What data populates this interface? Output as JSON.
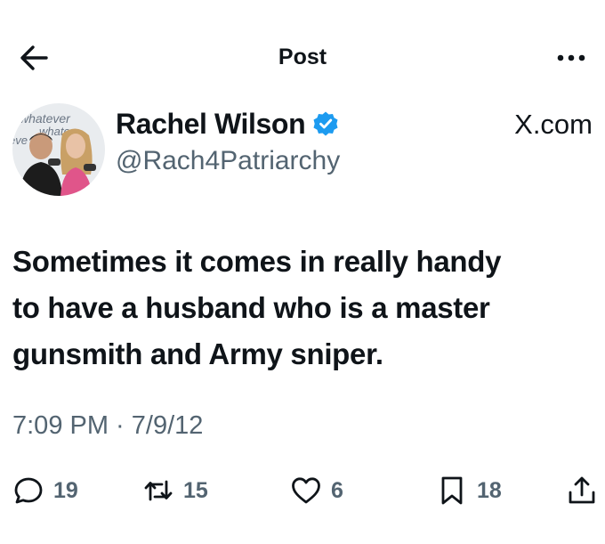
{
  "header": {
    "title": "Post",
    "back_icon": "arrow-left-icon",
    "more_icon": "more-horizontal-icon"
  },
  "author": {
    "display_name": "Rachel Wilson",
    "handle": "@Rach4Patriarchy",
    "verified": true,
    "verified_color": "#1d9bf0",
    "avatar_backdrop_text": "whatever"
  },
  "source_label": "X.com",
  "tweet": {
    "lines": [
      "Sometimes it comes in really handy",
      "to have a husband who is a master",
      "gunsmith and Army sniper."
    ]
  },
  "timestamp": "7:09 PM · 7/9/12",
  "actions": {
    "reply": {
      "icon": "reply-icon",
      "count": "19"
    },
    "repost": {
      "icon": "repost-icon",
      "count": "15"
    },
    "like": {
      "icon": "heart-icon",
      "count": "6"
    },
    "bookmark": {
      "icon": "bookmark-icon",
      "count": "18"
    },
    "share": {
      "icon": "share-icon"
    }
  },
  "colors": {
    "text": "#0f1419",
    "secondary": "#536471",
    "accent": "#1d9bf0"
  }
}
